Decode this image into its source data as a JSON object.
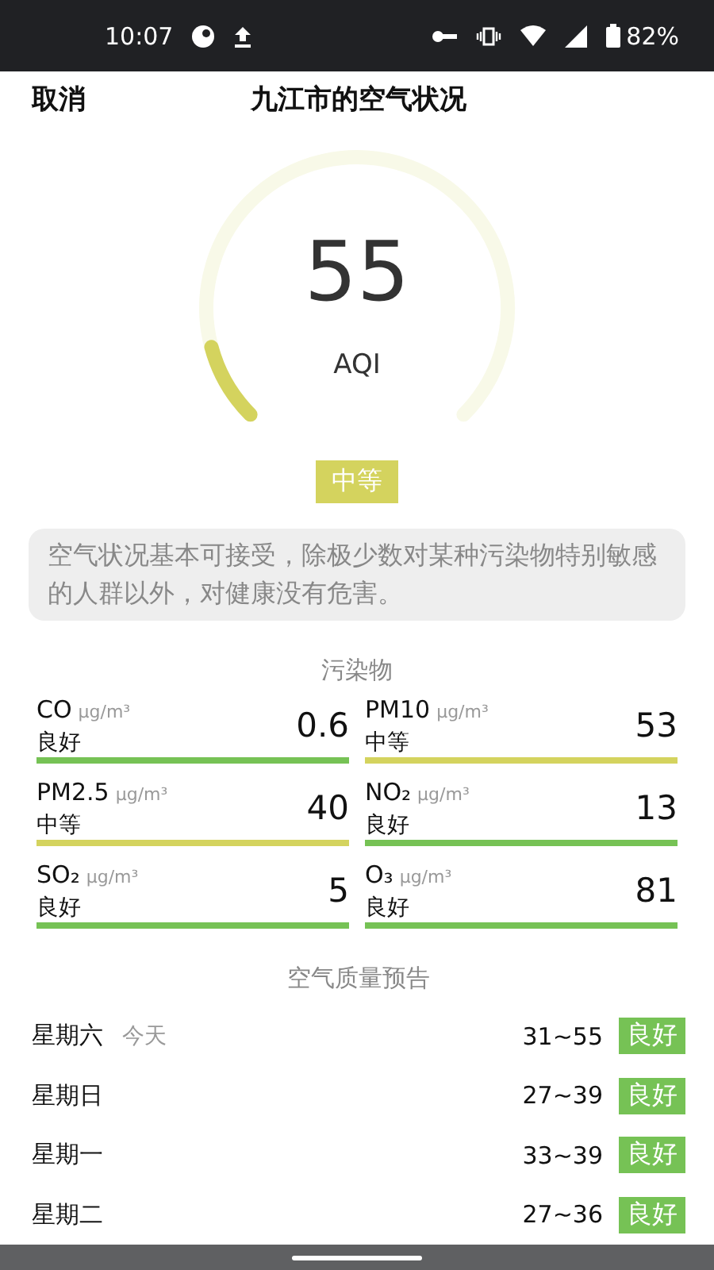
{
  "status_bar": {
    "time": "10:07",
    "battery": "82%"
  },
  "header": {
    "cancel": "取消",
    "title": "九江市的空气状况"
  },
  "gauge": {
    "value": "55",
    "label": "AQI",
    "category": "中等",
    "description": "空气状况基本可接受，除极少数对某种污染物特别敏感的人群以外，对健康没有危害。"
  },
  "pollutants": {
    "title": "污染物",
    "items": [
      {
        "name": "CO",
        "unit": "μg/m³",
        "status": "良好",
        "value": "0.6",
        "color": "#76c255"
      },
      {
        "name": "PM10",
        "unit": "μg/m³",
        "status": "中等",
        "value": "53",
        "color": "#d4d35e"
      },
      {
        "name": "PM2.5",
        "unit": "μg/m³",
        "status": "中等",
        "value": "40",
        "color": "#d4d35e"
      },
      {
        "name": "NO₂",
        "unit": "μg/m³",
        "status": "良好",
        "value": "13",
        "color": "#76c255"
      },
      {
        "name": "SO₂",
        "unit": "μg/m³",
        "status": "良好",
        "value": "5",
        "color": "#76c255"
      },
      {
        "name": "O₃",
        "unit": "μg/m³",
        "status": "良好",
        "value": "81",
        "color": "#76c255"
      }
    ]
  },
  "forecast": {
    "title": "空气质量预告",
    "days": [
      {
        "day": "星期六",
        "note": "今天",
        "range": "31~55",
        "quality": "良好",
        "color": "#76c255"
      },
      {
        "day": "星期日",
        "range": "27~39",
        "quality": "良好",
        "color": "#76c255"
      },
      {
        "day": "星期一",
        "range": "33~39",
        "quality": "良好",
        "color": "#76c255"
      },
      {
        "day": "星期二",
        "range": "27~36",
        "quality": "良好",
        "color": "#76c255"
      }
    ]
  }
}
